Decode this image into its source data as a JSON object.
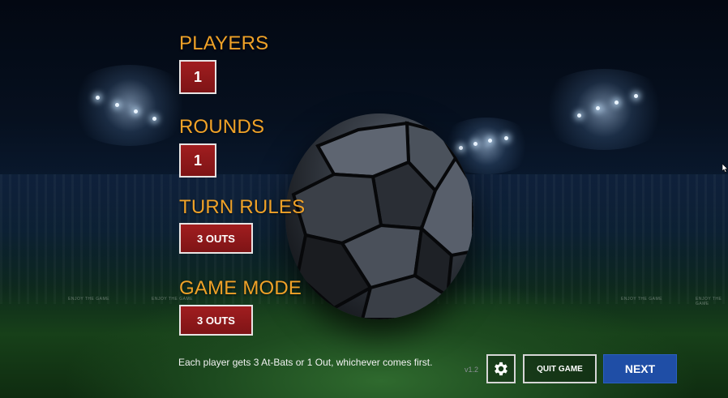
{
  "settings": {
    "players": {
      "label": "PLAYERS",
      "value": "1"
    },
    "rounds": {
      "label": "ROUNDS",
      "value": "1"
    },
    "turn_rules": {
      "label": "TURN RULES",
      "value": "3 OUTS"
    },
    "game_mode": {
      "label": "GAME MODE",
      "value": "3 OUTS"
    }
  },
  "footer": {
    "hint": "Each player gets 3 At-Bats or 1 Out, whichever comes first.",
    "version": "v1.2",
    "settings_icon": "gear-icon",
    "quit_label": "QUIT GAME",
    "next_label": "NEXT"
  },
  "background": {
    "banners": [
      "ENJOY THE GAME",
      "ENJOY THE GAME",
      "ENJOY THE GAME",
      "ENJOY THE GAME"
    ]
  },
  "colors": {
    "label": "#f0a228",
    "value_box": "#8f181a",
    "next_button": "#1f4ea6"
  }
}
